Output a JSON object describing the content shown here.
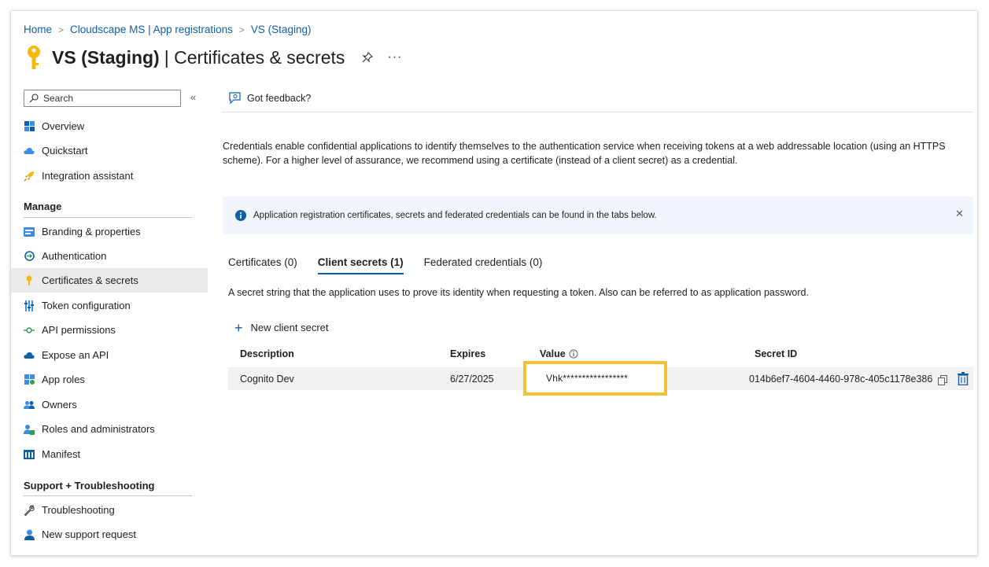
{
  "breadcrumb": [
    {
      "label": "Home"
    },
    {
      "label": "Cloudscape MS | App registrations"
    },
    {
      "label": "VS (Staging)"
    }
  ],
  "header": {
    "title_bold": "VS (Staging)",
    "title_rest": "| Certificates & secrets",
    "more_label": "···"
  },
  "sidebar": {
    "search_placeholder": "Search",
    "collapse_label": "«",
    "items_top": [
      {
        "label": "Overview",
        "icon": "grid-icon"
      },
      {
        "label": "Quickstart",
        "icon": "cloud-icon"
      },
      {
        "label": "Integration assistant",
        "icon": "rocket-icon"
      }
    ],
    "manage_heading": "Manage",
    "manage_items": [
      {
        "label": "Branding & properties",
        "icon": "branding-icon"
      },
      {
        "label": "Authentication",
        "icon": "authentication-icon"
      },
      {
        "label": "Certificates & secrets",
        "icon": "key-icon",
        "selected": true
      },
      {
        "label": "Token configuration",
        "icon": "token-icon"
      },
      {
        "label": "API permissions",
        "icon": "api-permissions-icon"
      },
      {
        "label": "Expose an API",
        "icon": "cloud-api-icon"
      },
      {
        "label": "App roles",
        "icon": "app-roles-icon"
      },
      {
        "label": "Owners",
        "icon": "owners-icon"
      },
      {
        "label": "Roles and administrators",
        "icon": "roles-icon"
      },
      {
        "label": "Manifest",
        "icon": "manifest-icon"
      }
    ],
    "support_heading": "Support + Troubleshooting",
    "support_items": [
      {
        "label": "Troubleshooting",
        "icon": "wrench-icon"
      },
      {
        "label": "New support request",
        "icon": "support-icon"
      }
    ]
  },
  "main": {
    "feedback_label": "Got feedback?",
    "description": "Credentials enable confidential applications to identify themselves to the authentication service when receiving tokens at a web addressable location (using an HTTPS scheme). For a higher level of assurance, we recommend using a certificate (instead of a client secret) as a credential.",
    "info_banner": "Application registration certificates, secrets and federated credentials can be found in the tabs below.",
    "info_close": "✕",
    "tabs": [
      {
        "label": "Certificates (0)",
        "active": false
      },
      {
        "label": "Client secrets (1)",
        "active": true
      },
      {
        "label": "Federated credentials (0)",
        "active": false
      }
    ],
    "secret_description": "A secret string that the application uses to prove its identity when requesting a token. Also can be referred to as application password.",
    "new_secret_label": "New client secret",
    "table": {
      "columns": [
        "Description",
        "Expires",
        "Value",
        "Secret ID"
      ],
      "rows": [
        {
          "description": "Cognito Dev",
          "expires": "6/27/2025",
          "value": "Vhk*****************",
          "secret_id": "014b6ef7-4604-4460-978c-405c1178e386"
        }
      ]
    }
  },
  "colors": {
    "accent": "#0f5ea8",
    "highlight": "#f2c230",
    "selected_bg": "#edebe9",
    "info_bg": "#f0f6fc"
  }
}
